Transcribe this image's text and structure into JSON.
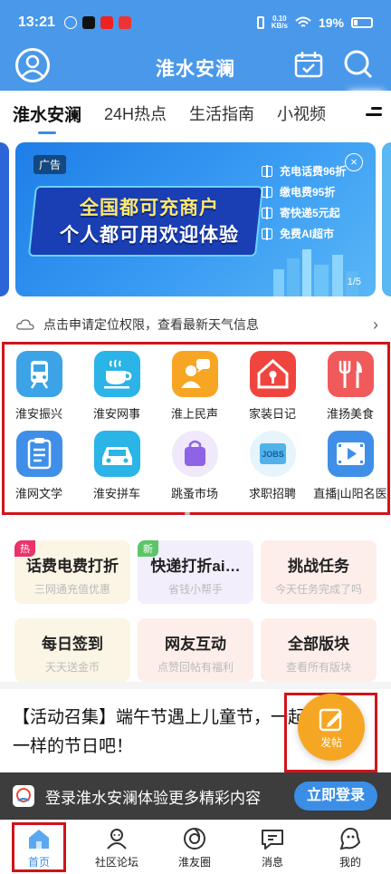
{
  "status_bar": {
    "time": "13:21",
    "net_speed_value": "0.10",
    "net_speed_unit": "KB/s",
    "battery": "19%"
  },
  "header": {
    "title": "淮水安澜"
  },
  "tabs": [
    {
      "label": "淮水安澜",
      "active": true
    },
    {
      "label": "24H热点",
      "active": false
    },
    {
      "label": "生活指南",
      "active": false
    },
    {
      "label": "小视频",
      "active": false
    }
  ],
  "banner": {
    "ad_tag": "广告",
    "slogan_line1": "全国都可充商户",
    "slogan_line2": "个人都可用欢迎体验",
    "perks": [
      "充电话费96折",
      "缴电费95折",
      "寄快递5元起",
      "免费AI超市"
    ],
    "page_indicator": "1/5"
  },
  "weather": {
    "text": "点击申请定位权限，查看最新天气信息"
  },
  "icon_grid": [
    {
      "label": "淮安振兴",
      "icon": "train-icon",
      "color": "#3ba3e6"
    },
    {
      "label": "淮安网事",
      "icon": "coffee-cup-icon",
      "color": "#2ab4e8"
    },
    {
      "label": "淮上民声",
      "icon": "person-speech-icon",
      "color": "#f6a623"
    },
    {
      "label": "家装日记",
      "icon": "house-icon",
      "color": "#f0453e"
    },
    {
      "label": "淮扬美食",
      "icon": "fork-knife-icon",
      "color": "#f05a5a"
    },
    {
      "label": "淮网文学",
      "icon": "document-icon",
      "color": "#3f8fe8"
    },
    {
      "label": "淮安拼车",
      "icon": "car-icon",
      "color": "#2ab4e8"
    },
    {
      "label": "跳蚤市场",
      "icon": "shopping-bag-icon",
      "color": "#8e63e6"
    },
    {
      "label": "求职招聘",
      "icon": "jobs-icon",
      "color": "#4fb3ea"
    },
    {
      "label": "直播|山阳名医",
      "icon": "film-icon",
      "color": "#3f8fe8"
    }
  ],
  "task_cards": [
    {
      "title": "话费电费打折",
      "subtitle": "三网通充值优惠",
      "badge": "热",
      "badge_color": "#e8336b",
      "bg": "#fbf5e6"
    },
    {
      "title": "快递打折ai…",
      "subtitle": "省钱小帮手",
      "badge": "新",
      "badge_color": "#5cc56a",
      "bg": "#f2eefc"
    },
    {
      "title": "挑战任务",
      "subtitle": "今天任务完成了吗",
      "badge": "",
      "badge_color": "",
      "bg": "#fdeeea"
    },
    {
      "title": "每日签到",
      "subtitle": "天天送金币",
      "badge": "",
      "badge_color": "",
      "bg": "#fbf5e6"
    },
    {
      "title": "网友互动",
      "subtitle": "点赞回帖有福利",
      "badge": "",
      "badge_color": "",
      "bg": "#fdeeea"
    },
    {
      "title": "全部版块",
      "subtitle": "查看所有版块",
      "badge": "",
      "badge_color": "",
      "bg": "#fdeeea"
    }
  ],
  "article": {
    "line1": "【活动召集】端午节遇上儿童节，一起迎",
    "line2": "一样的节日吧！"
  },
  "post_button": {
    "label": "发帖"
  },
  "login_bar": {
    "text": "登录淮水安澜体验更多精彩内容",
    "button": "立即登录"
  },
  "bottom_nav": [
    {
      "label": "首页",
      "icon": "home-icon",
      "active": true
    },
    {
      "label": "社区论坛",
      "icon": "community-icon",
      "active": false
    },
    {
      "label": "淮友圈",
      "icon": "circle-icon",
      "active": false
    },
    {
      "label": "消息",
      "icon": "message-icon",
      "active": false
    },
    {
      "label": "我的",
      "icon": "profile-icon",
      "active": false
    }
  ],
  "colors": {
    "brand_blue": "#4a98ea",
    "highlight_red": "#d0141a",
    "post_orange": "#f5a623"
  }
}
